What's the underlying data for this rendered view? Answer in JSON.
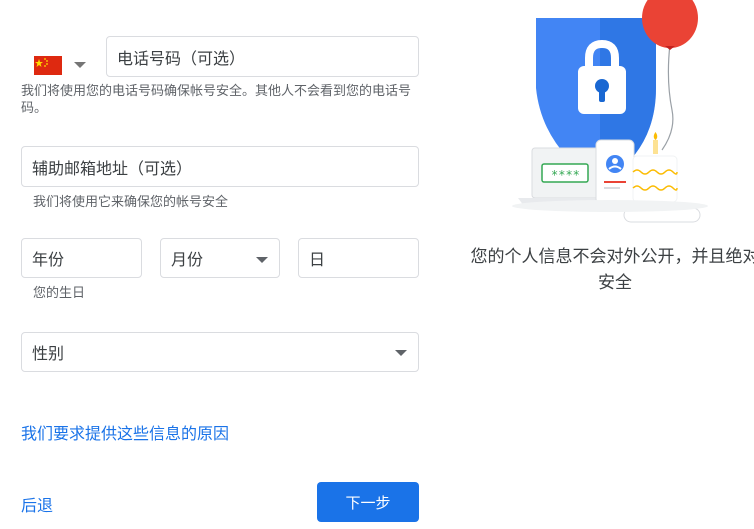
{
  "phone": {
    "country_flag": "china-flag-icon",
    "placeholder": "电话号码（可选）",
    "helper": "我们将使用您的电话号码确保帐号安全。其他人不会看到您的电话号码。"
  },
  "recovery_email": {
    "placeholder": "辅助邮箱地址（可选）",
    "helper": "我们将使用它来确保您的帐号安全"
  },
  "birthday": {
    "year_placeholder": "年份",
    "month_placeholder": "月份",
    "day_placeholder": "日",
    "helper": "您的生日"
  },
  "gender": {
    "placeholder": "性别"
  },
  "why_link": "我们要求提供这些信息的原因",
  "back_label": "后退",
  "next_label": "下一步",
  "tagline": "您的个人信息不会对外公开，并且绝对安全",
  "illustration": {
    "password_mask": "****"
  },
  "colors": {
    "accent": "#1a73e8",
    "shield": "#4285f4",
    "balloon": "#ea4335"
  }
}
